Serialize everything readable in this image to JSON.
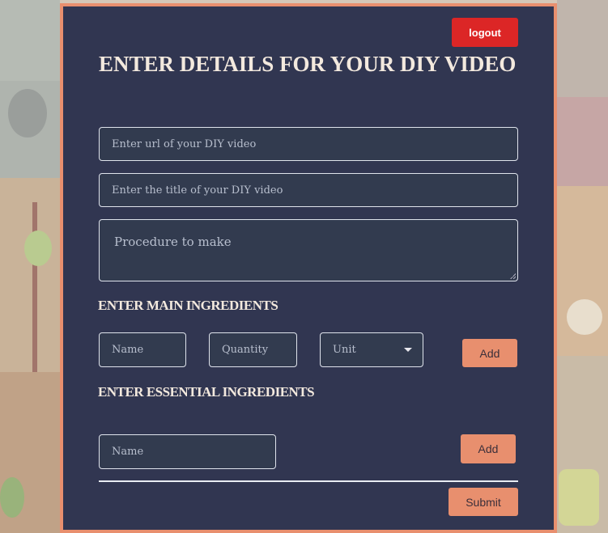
{
  "header": {
    "logout_label": "logout"
  },
  "form": {
    "title": "ENTER DETAILS FOR YOUR DIY VIDEO",
    "url_placeholder": "Enter url of your DIY video",
    "title_placeholder": "Enter the title of your DIY video",
    "procedure_placeholder": "Procedure to make"
  },
  "main_ingredients": {
    "heading": "ENTER MAIN INGREDIENTS",
    "name_placeholder": "Name",
    "quantity_placeholder": "Quantity",
    "unit_selected": "Unit",
    "add_label": "Add"
  },
  "essential_ingredients": {
    "heading": "ENTER ESSENTIAL INGREDIENTS",
    "name_placeholder": "Name",
    "add_label": "Add"
  },
  "submit_label": "Submit",
  "colors": {
    "panel": "#313651",
    "panel_border": "#e88f6e",
    "logout": "#dc2626",
    "accent_button": "#e88f6e",
    "heading_text": "#f3e9de"
  },
  "icons": {
    "unit_dropdown": "caret-down-icon"
  }
}
